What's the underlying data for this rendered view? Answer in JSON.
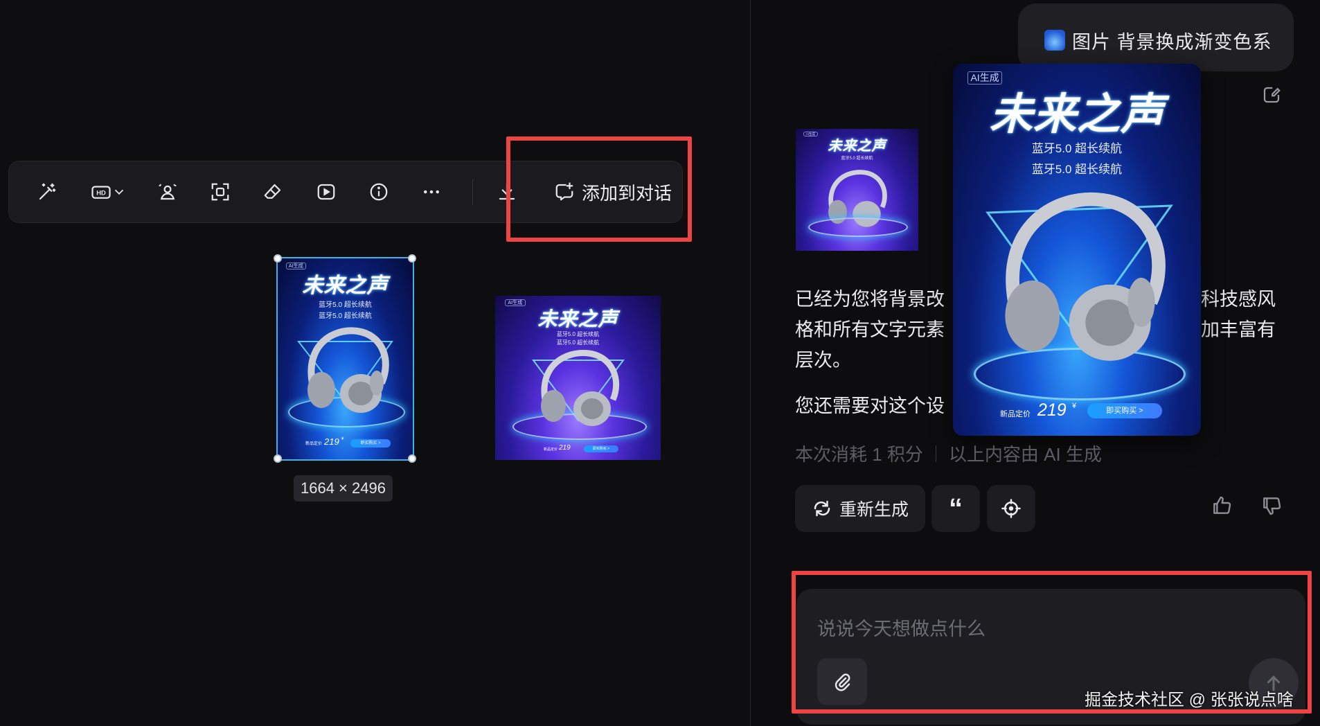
{
  "toolbar": {
    "items": [
      {
        "name": "magic-wand-icon"
      },
      {
        "name": "hd-icon",
        "label": "HD"
      },
      {
        "name": "person-cutout-icon"
      },
      {
        "name": "expand-frame-icon"
      },
      {
        "name": "eraser-icon"
      },
      {
        "name": "play-video-icon"
      },
      {
        "name": "info-icon"
      },
      {
        "name": "more-icon"
      },
      {
        "name": "download-icon"
      }
    ],
    "add_to_chat_label": "添加到对话"
  },
  "canvas": {
    "selected_dimensions": "1664 × 2496",
    "poster": {
      "ai_tag": "AI生成",
      "title": "未来之声",
      "subtitle_line": "蓝牙5.0 超长续航",
      "price_label": "新品定价",
      "price": "219",
      "currency": "¥",
      "buy_label": "即买购买 >"
    }
  },
  "chat": {
    "user_message": "图片 背景换成渐变色系",
    "reply_line1": "已经为您将背景改",
    "reply_line1_tail": "科技感风",
    "reply_line2": "格和所有文字元素",
    "reply_line2_tail": "加丰富有",
    "reply_line3": "层次。",
    "reply_question": "您还需要对这个设",
    "cost_text": "本次消耗 1 积分",
    "ai_notice": "以上内容由 AI 生成",
    "regenerate_label": "重新生成",
    "quote_symbol": "“"
  },
  "input": {
    "placeholder": "说说今天想做点什么"
  },
  "watermark": "掘金技术社区 @ 张张说点啥",
  "colors": {
    "highlight_red": "#ef4444",
    "background": "#0e0e10",
    "panel": "#1d1d22"
  }
}
